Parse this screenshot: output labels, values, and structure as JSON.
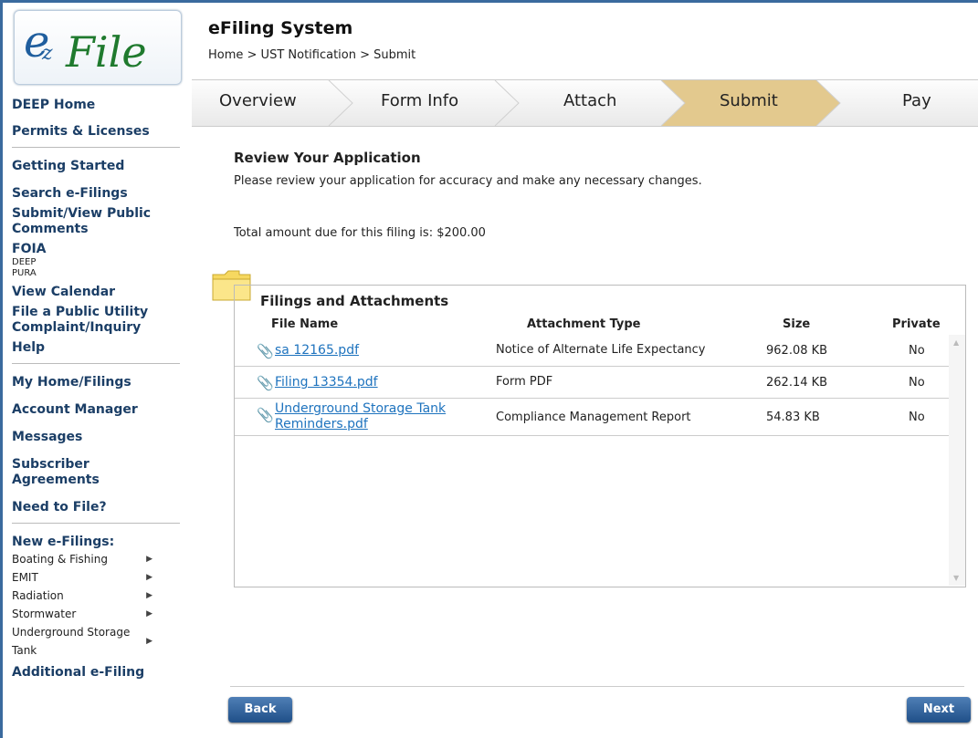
{
  "sidebar": {
    "logo_text": "ezFile",
    "group1": [
      "DEEP Home",
      "Permits & Licenses"
    ],
    "group2": [
      "Getting Started",
      "Search e-Filings",
      "Submit/View Public Comments"
    ],
    "foia": {
      "label": "FOIA",
      "sub": [
        "DEEP",
        "PURA"
      ]
    },
    "group3": [
      "View Calendar",
      "File a Public Utility Complaint/Inquiry",
      "Help"
    ],
    "group4": [
      "My Home/Filings",
      "Account Manager",
      "Messages",
      "Subscriber Agreements",
      "Need to File?"
    ],
    "new_efilings": {
      "label": "New e-Filings:",
      "items": [
        "Boating & Fishing",
        "EMIT",
        "Radiation",
        "Stormwater",
        "Underground Storage Tank"
      ]
    },
    "additional": "Additional e-Filing"
  },
  "header": {
    "title": "eFiling System",
    "breadcrumb": "Home > UST Notification > Submit"
  },
  "steps": [
    "Overview",
    "Form Info",
    "Attach",
    "Submit",
    "Pay"
  ],
  "active_step": "Submit",
  "review": {
    "title": "Review Your Application",
    "text": "Please review your application for accuracy and make any necessary changes.",
    "total": "Total amount due for this filing is: $200.00"
  },
  "attachments": {
    "title": "Filings and Attachments",
    "columns": [
      "File Name",
      "Attachment Type",
      "Size",
      "Private"
    ],
    "rows": [
      {
        "name": "sa 12165.pdf",
        "type": "Notice of Alternate Life Expectancy",
        "size": "962.08 KB",
        "private": "No"
      },
      {
        "name": "Filing 13354.pdf",
        "type": "Form PDF",
        "size": "262.14 KB",
        "private": "No"
      },
      {
        "name": "Underground Storage Tank Reminders.pdf",
        "type": "Compliance Management Report",
        "size": "54.83 KB",
        "private": "No"
      }
    ]
  },
  "buttons": {
    "back": "Back",
    "next": "Next"
  },
  "colors": {
    "frame": "#3a6a9e",
    "active_step": "#e6c98a",
    "link": "#1e73be",
    "button": "#2f5f98"
  }
}
